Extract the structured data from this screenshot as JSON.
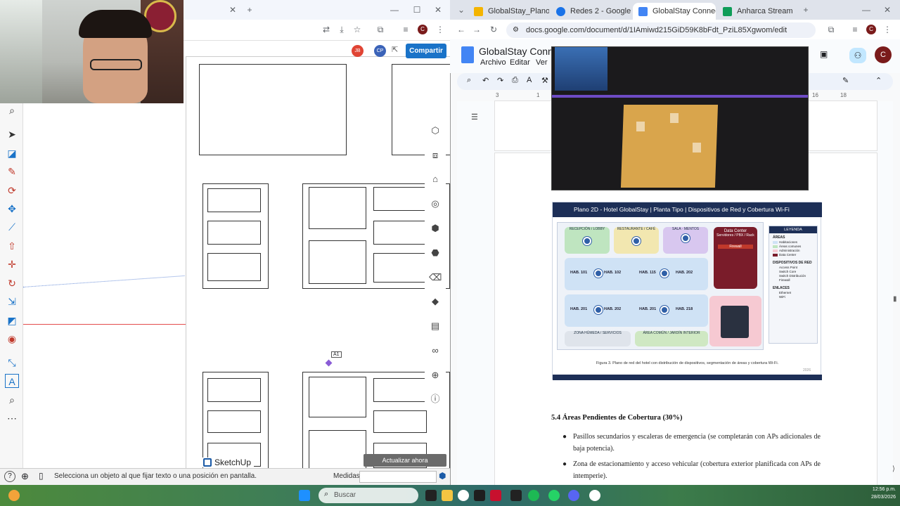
{
  "left_browser": {
    "share_button": "Compartir",
    "avatar_initials_1": "JB",
    "avatar_initials_2": "CP",
    "profile_initial": "C",
    "brand": "SketchUp",
    "update_button": "Actualizar ahora",
    "status_text": "Selecciona un objeto al que fijar texto o una posición en pantalla.",
    "measures_label": "Medidas",
    "measures_value": "",
    "text_tag": "A1"
  },
  "right_browser": {
    "tabs": [
      {
        "label": "GlobalStay_Plano2D",
        "color": "#f4b400"
      },
      {
        "label": "Redes 2 - Google D",
        "color": "#1a73e8"
      },
      {
        "label": "GlobalStay Connec",
        "color": "#4285f4"
      },
      {
        "label": "Anharca Stream",
        "color": "#0f9d58"
      }
    ],
    "url": "docs.google.com/document/d/1IAmiwd215GiD59K8bFdt_PziL85Xgwom/edit",
    "doc_title": "GlobalStay Connec",
    "menu": [
      "Archivo",
      "Editar",
      "Ver"
    ],
    "profile_initial": "C",
    "ruler_marks": [
      "3",
      "1",
      "16",
      "18"
    ]
  },
  "figure": {
    "header": "Plano 2D - Hotel GlobalStay | Planta Tipo | Dispositivos de Red y Cobertura Wi-Fi",
    "zones": {
      "reception": "RECEPCIÓN / LOBBY",
      "restaurant": "RESTAURANTE / CAFÉ",
      "meetings": "SALA · MENTOS",
      "datacenter": "Data Center",
      "datacenter_sub": "Servidores / PBX / Rack",
      "firewall": "Firewall",
      "wet_zone": "ZONA HÚMEDA / SERVICIOS",
      "common": "ÁREA COMÚN / JARDÍN INTERIOR"
    },
    "rooms": [
      "HAB. 101",
      "HAB. 102",
      "HAB. 115",
      "HAB. 202",
      "HAB. 201",
      "HAB. 202",
      "HAB. 201",
      "HAB. 218"
    ],
    "legend_title": "LEYENDA",
    "legend_areas_title": "ÁREAS",
    "legend_areas": [
      "Habitaciones",
      "Áreas comunes",
      "Administración",
      "Data Center"
    ],
    "legend_devices_title": "DISPOSITIVOS DE RED",
    "legend_devices": [
      "Access Point",
      "Switch Core",
      "Switch Distribución",
      "Firewall"
    ],
    "legend_links_title": "ENLACES",
    "legend_links": [
      "Ethernet",
      "WiFi"
    ],
    "caption": "Figura 3. Plano de red del hotel con distribución de dispositivos, segmentación de áreas y cobertura Wi-Fi.",
    "page_number": "2026"
  },
  "doc": {
    "section_heading": "5.4 Áreas Pendientes de Cobertura (30%)",
    "bullets": [
      "Pasillos secundarios y escaleras de emergencia (se completarán con APs adicionales de baja potencia).",
      "Zona de estacionamiento y acceso vehicular (cobertura exterior planificada con APs de intemperie)."
    ]
  },
  "taskbar": {
    "search_placeholder": "Buscar",
    "time": "12:56 p.m.",
    "date": "28/03/2026"
  }
}
